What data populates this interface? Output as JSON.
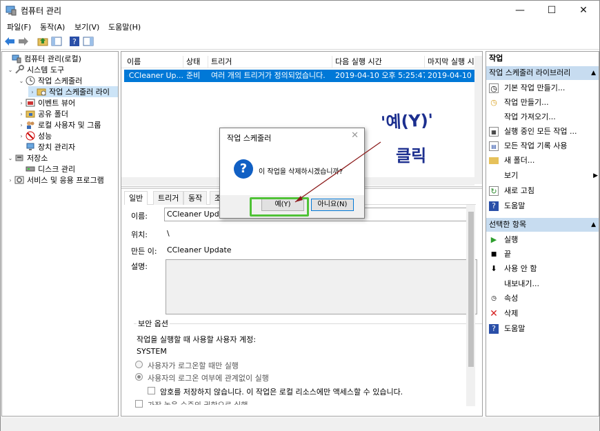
{
  "window": {
    "title": "컴퓨터 관리",
    "controls": {
      "minimize": "—",
      "maximize": "☐",
      "close": "✕"
    }
  },
  "menu": [
    "파일(F)",
    "동작(A)",
    "보기(V)",
    "도움말(H)"
  ],
  "tree": [
    {
      "label": "컴퓨터 관리(로컬)",
      "expander": ""
    },
    {
      "label": "시스템 도구",
      "expander": "⌄"
    },
    {
      "label": "작업 스케줄러",
      "expander": "⌄"
    },
    {
      "label": "작업 스케줄러 라이",
      "expander": "›"
    },
    {
      "label": "이벤트 뷰어",
      "expander": "›"
    },
    {
      "label": "공유 폴더",
      "expander": "›"
    },
    {
      "label": "로컬 사용자 및 그룹",
      "expander": "›"
    },
    {
      "label": "성능",
      "expander": "›"
    },
    {
      "label": "장치 관리자",
      "expander": ""
    },
    {
      "label": "저장소",
      "expander": "⌄"
    },
    {
      "label": "디스크 관리",
      "expander": ""
    },
    {
      "label": "서비스 및 응용 프로그램",
      "expander": "›"
    }
  ],
  "task_list": {
    "columns": [
      "이름",
      "상태",
      "트리거",
      "다음 실행 시간",
      "마지막 실행 시"
    ],
    "row": {
      "name": "CCleaner Up...",
      "status": "준비",
      "trigger": "여러 개의 트리거가 정의되었습니다.",
      "next_run": "2019-04-10 오후 5:25:47",
      "last_run": "2019-04-10 오"
    }
  },
  "tabs": [
    "일반",
    "트리거",
    "동작",
    "조"
  ],
  "properties": {
    "name_label": "이름:",
    "name_value": "CCleaner Update",
    "location_label": "위치:",
    "location_value": "\\",
    "author_label": "만든 이:",
    "author_value": "CCleaner Update",
    "desc_label": "설명:",
    "security_title": "보안 옵션",
    "account_label": "작업을 실행할 때 사용할 사용자 계정:",
    "account_value": "SYSTEM",
    "radio1": "사용자가 로그온할 때만 실행",
    "radio2": "사용자의 로그온 여부에 관계없이 실행",
    "check1": "암호를 저장하지 않습니다. 이 작업은 로컬 리소스에만 액세스할 수 있습니다.",
    "check2": "가장 높은 수준의 권한으로 실행"
  },
  "actions": {
    "header": "작업",
    "section1": "작업 스케줄러 라이브러리",
    "items1": [
      {
        "label": "기본 작업 만들기...",
        "icon": "basic-task-icon"
      },
      {
        "label": "작업 만들기...",
        "icon": "create-task-icon"
      },
      {
        "label": "작업 가져오기...",
        "icon": ""
      },
      {
        "label": "실행 중인 모든 작업 ...",
        "icon": "running-tasks-icon"
      },
      {
        "label": "모든 작업 기록 사용",
        "icon": "history-icon"
      },
      {
        "label": "새 폴더...",
        "icon": "folder-icon"
      },
      {
        "label": "보기",
        "icon": ""
      },
      {
        "label": "새로 고침",
        "icon": "refresh-icon"
      },
      {
        "label": "도움말",
        "icon": "help-icon"
      }
    ],
    "section2": "선택한 항목",
    "items2": [
      {
        "label": "실행",
        "icon": "run-icon"
      },
      {
        "label": "끝",
        "icon": "stop-icon"
      },
      {
        "label": "사용 안 함",
        "icon": "disable-icon"
      },
      {
        "label": "내보내기...",
        "icon": ""
      },
      {
        "label": "속성",
        "icon": "properties-icon"
      },
      {
        "label": "삭제",
        "icon": "delete-icon"
      },
      {
        "label": "도움말",
        "icon": "help-icon"
      }
    ]
  },
  "dialog": {
    "title": "작업 스케줄러",
    "message": "이 작업을 삭제하시겠습니까?",
    "yes": "예(Y)",
    "no": "아니요(N)"
  },
  "annotation": {
    "line1": "'예(Y)'",
    "line2": "클릭"
  },
  "colors": {
    "selection": "#0078d7",
    "highlight": "#4fc236",
    "annotation": "#1c2f8f",
    "section_header": "#c7dcf0"
  }
}
